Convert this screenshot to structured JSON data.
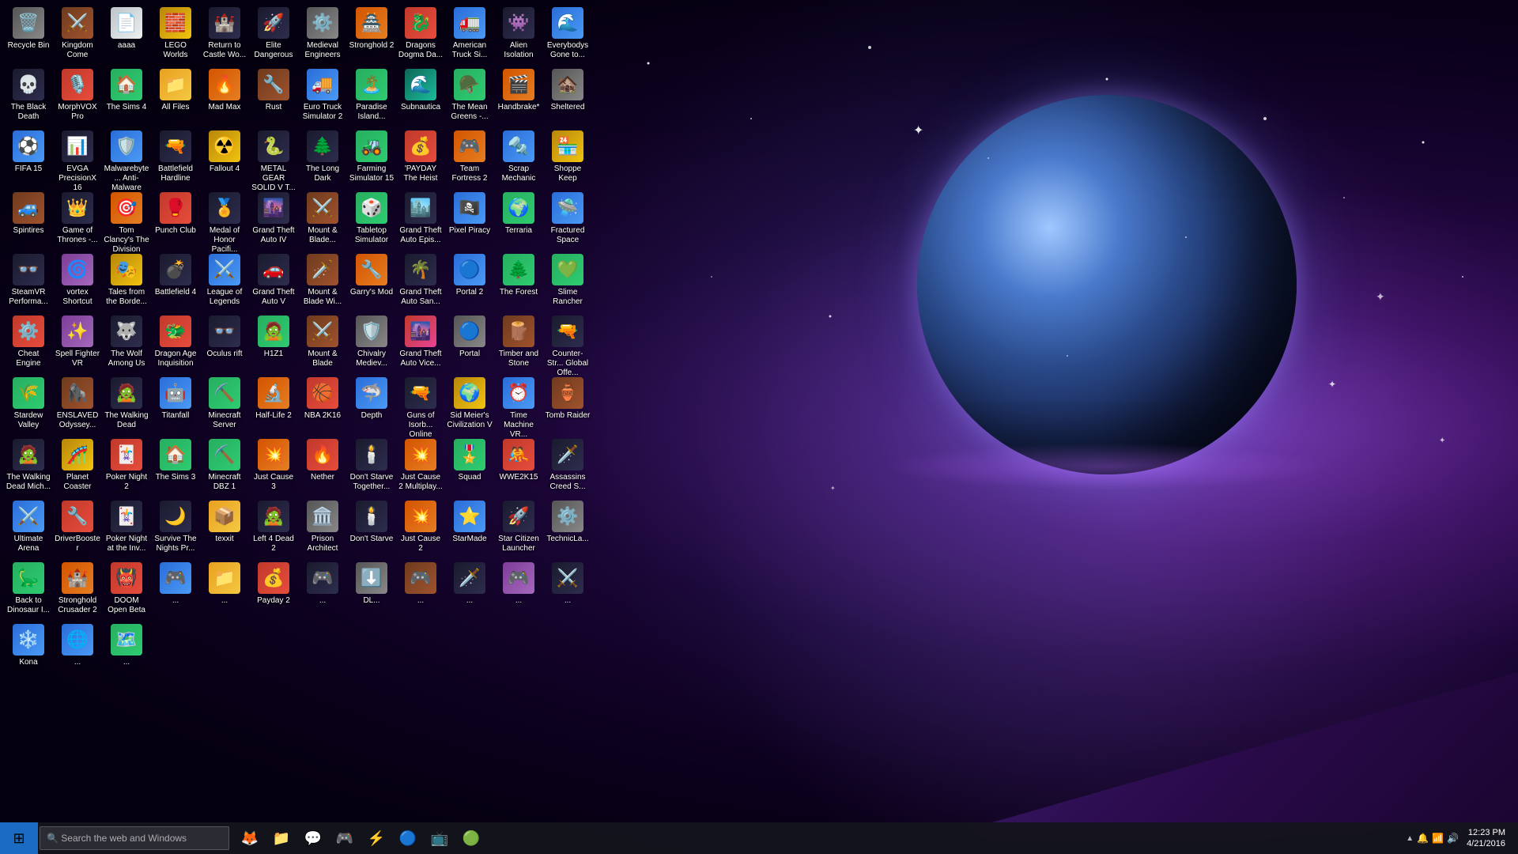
{
  "desktop": {
    "icons": [
      {
        "id": "recycle-bin",
        "label": "Recycle Bin",
        "emoji": "🗑️",
        "color": "ic-gray"
      },
      {
        "id": "kingdom-come",
        "label": "Kingdom Come",
        "emoji": "⚔️",
        "color": "ic-brown"
      },
      {
        "id": "aaaa",
        "label": "aaaa",
        "emoji": "📄",
        "color": "ic-white"
      },
      {
        "id": "lego-worlds",
        "label": "LEGO Worlds",
        "emoji": "🧱",
        "color": "ic-yellow"
      },
      {
        "id": "return-castle",
        "label": "Return to Castle Wo...",
        "emoji": "🏰",
        "color": "ic-dark"
      },
      {
        "id": "elite-dangerous",
        "label": "Elite Dangerous",
        "emoji": "🚀",
        "color": "ic-dark"
      },
      {
        "id": "medieval-engineers",
        "label": "Medieval Engineers",
        "emoji": "⚙️",
        "color": "ic-gray"
      },
      {
        "id": "stronghold-2",
        "label": "Stronghold 2",
        "emoji": "🏯",
        "color": "ic-orange"
      },
      {
        "id": "dragons-dogma",
        "label": "Dragons Dogma Da...",
        "emoji": "🐉",
        "color": "ic-red"
      },
      {
        "id": "american-truck",
        "label": "American Truck Si...",
        "emoji": "🚛",
        "color": "ic-blue"
      },
      {
        "id": "alien-isolation",
        "label": "Alien Isolation",
        "emoji": "👾",
        "color": "ic-dark"
      },
      {
        "id": "everybodys-gone",
        "label": "Everybodys Gone to...",
        "emoji": "🌊",
        "color": "ic-blue"
      },
      {
        "id": "the-black-death",
        "label": "The Black Death",
        "emoji": "💀",
        "color": "ic-dark"
      },
      {
        "id": "morphvox",
        "label": "MorphVOX Pro",
        "emoji": "🎙️",
        "color": "ic-red"
      },
      {
        "id": "the-sims-4",
        "label": "The Sims 4",
        "emoji": "🏠",
        "color": "ic-green"
      },
      {
        "id": "all-files",
        "label": "All Files",
        "emoji": "📁",
        "color": "ic-folder"
      },
      {
        "id": "mad-max",
        "label": "Mad Max",
        "emoji": "🔥",
        "color": "ic-orange"
      },
      {
        "id": "rust",
        "label": "Rust",
        "emoji": "🔧",
        "color": "ic-brown"
      },
      {
        "id": "euro-truck-2",
        "label": "Euro Truck Simulator 2",
        "emoji": "🚚",
        "color": "ic-blue"
      },
      {
        "id": "paradise-island",
        "label": "Paradise Island...",
        "emoji": "🏝️",
        "color": "ic-green"
      },
      {
        "id": "subnautica",
        "label": "Subnautica",
        "emoji": "🌊",
        "color": "ic-teal"
      },
      {
        "id": "the-mean-greens",
        "label": "The Mean Greens -...",
        "emoji": "🪖",
        "color": "ic-green"
      },
      {
        "id": "handbrake",
        "label": "Handbrake*",
        "emoji": "🎬",
        "color": "ic-orange"
      },
      {
        "id": "sheltered",
        "label": "Sheltered",
        "emoji": "🏚️",
        "color": "ic-gray"
      },
      {
        "id": "fifa-15",
        "label": "FIFA 15",
        "emoji": "⚽",
        "color": "ic-blue"
      },
      {
        "id": "evga-precision",
        "label": "EVGA PrecisionX 16",
        "emoji": "📊",
        "color": "ic-dark"
      },
      {
        "id": "malwarebytes",
        "label": "Malwarebyte... Anti-Malware",
        "emoji": "🛡️",
        "color": "ic-blue"
      },
      {
        "id": "battlefield-hardline",
        "label": "Battlefield Hardline",
        "emoji": "🔫",
        "color": "ic-dark"
      },
      {
        "id": "fallout-4",
        "label": "Fallout 4",
        "emoji": "☢️",
        "color": "ic-yellow"
      },
      {
        "id": "metal-gear",
        "label": "METAL GEAR SOLID V T...",
        "emoji": "🐍",
        "color": "ic-dark"
      },
      {
        "id": "the-long-dark",
        "label": "The Long Dark",
        "emoji": "🌲",
        "color": "ic-dark"
      },
      {
        "id": "farming-sim-15",
        "label": "Farming Simulator 15",
        "emoji": "🚜",
        "color": "ic-green"
      },
      {
        "id": "payday-heist",
        "label": "'PAYDAY The Heist",
        "emoji": "💰",
        "color": "ic-red"
      },
      {
        "id": "team-fortress",
        "label": "Team Fortress 2",
        "emoji": "🎮",
        "color": "ic-orange"
      },
      {
        "id": "scrap-mechanic",
        "label": "Scrap Mechanic",
        "emoji": "🔩",
        "color": "ic-blue"
      },
      {
        "id": "shoppe-keep",
        "label": "Shoppe Keep",
        "emoji": "🏪",
        "color": "ic-yellow"
      },
      {
        "id": "spintires",
        "label": "Spintires",
        "emoji": "🚙",
        "color": "ic-brown"
      },
      {
        "id": "game-of-thrones",
        "label": "Game of Thrones -...",
        "emoji": "👑",
        "color": "ic-dark"
      },
      {
        "id": "tom-clancy-division",
        "label": "Tom Clancy's The Division",
        "emoji": "🎯",
        "color": "ic-orange"
      },
      {
        "id": "punch-club",
        "label": "Punch Club",
        "emoji": "🥊",
        "color": "ic-red"
      },
      {
        "id": "medal-honor",
        "label": "Medal of Honor Pacifi...",
        "emoji": "🏅",
        "color": "ic-dark"
      },
      {
        "id": "gta-iv",
        "label": "Grand Theft Auto IV",
        "emoji": "🌆",
        "color": "ic-dark"
      },
      {
        "id": "mount-blade",
        "label": "Mount & Blade...",
        "emoji": "⚔️",
        "color": "ic-brown"
      },
      {
        "id": "tabletop-sim",
        "label": "Tabletop Simulator",
        "emoji": "🎲",
        "color": "ic-green"
      },
      {
        "id": "gta-episodes",
        "label": "Grand Theft Auto Epis...",
        "emoji": "🏙️",
        "color": "ic-dark"
      },
      {
        "id": "pixel-piracy",
        "label": "Pixel Piracy",
        "emoji": "🏴‍☠️",
        "color": "ic-blue"
      },
      {
        "id": "terraria",
        "label": "Terraria",
        "emoji": "🌍",
        "color": "ic-green"
      },
      {
        "id": "fractured-space",
        "label": "Fractured Space",
        "emoji": "🛸",
        "color": "ic-blue"
      },
      {
        "id": "steamvr",
        "label": "SteamVR Performa...",
        "emoji": "👓",
        "color": "ic-dark"
      },
      {
        "id": "vortex",
        "label": "vortex Shortcut",
        "emoji": "🌀",
        "color": "ic-purple"
      },
      {
        "id": "tales-borderlands",
        "label": "Tales from the Borde...",
        "emoji": "🎭",
        "color": "ic-yellow"
      },
      {
        "id": "battlefield-4",
        "label": "Battlefield 4",
        "emoji": "💣",
        "color": "ic-dark"
      },
      {
        "id": "league-legends",
        "label": "League of Legends",
        "emoji": "⚔️",
        "color": "ic-blue"
      },
      {
        "id": "gta-v",
        "label": "Grand Theft Auto V",
        "emoji": "🚗",
        "color": "ic-dark"
      },
      {
        "id": "mount-blade-war",
        "label": "Mount & Blade Wi...",
        "emoji": "🗡️",
        "color": "ic-brown"
      },
      {
        "id": "garrys-mod",
        "label": "Garry's Mod",
        "emoji": "🔧",
        "color": "ic-orange"
      },
      {
        "id": "gta-san",
        "label": "Grand Theft Auto San...",
        "emoji": "🌴",
        "color": "ic-dark"
      },
      {
        "id": "portal-2",
        "label": "Portal 2",
        "emoji": "🔵",
        "color": "ic-blue"
      },
      {
        "id": "the-forest",
        "label": "The Forest",
        "emoji": "🌲",
        "color": "ic-green"
      },
      {
        "id": "slime-rancher",
        "label": "Slime Rancher",
        "emoji": "💚",
        "color": "ic-green"
      },
      {
        "id": "cheat-engine",
        "label": "Cheat Engine",
        "emoji": "⚙️",
        "color": "ic-red"
      },
      {
        "id": "spell-fighter",
        "label": "Spell Fighter VR",
        "emoji": "✨",
        "color": "ic-purple"
      },
      {
        "id": "wolf-among-us",
        "label": "The Wolf Among Us",
        "emoji": "🐺",
        "color": "ic-dark"
      },
      {
        "id": "dragon-age",
        "label": "Dragon Age Inquisition",
        "emoji": "🐲",
        "color": "ic-red"
      },
      {
        "id": "oculus-rift",
        "label": "Oculus rift",
        "emoji": "👓",
        "color": "ic-dark"
      },
      {
        "id": "h1z1",
        "label": "H1Z1",
        "emoji": "🧟",
        "color": "ic-green"
      },
      {
        "id": "mount-blade-2",
        "label": "Mount & Blade",
        "emoji": "⚔️",
        "color": "ic-brown"
      },
      {
        "id": "chivalry",
        "label": "Chivalry Mediev...",
        "emoji": "🛡️",
        "color": "ic-gray"
      },
      {
        "id": "gta-vice",
        "label": "Grand Theft Auto Vice...",
        "emoji": "🌆",
        "color": "ic-pink"
      },
      {
        "id": "portal",
        "label": "Portal",
        "emoji": "🔵",
        "color": "ic-gray"
      },
      {
        "id": "timber-stone",
        "label": "Timber and Stone",
        "emoji": "🪵",
        "color": "ic-brown"
      },
      {
        "id": "csgo",
        "label": "Counter-Str... Global Offe...",
        "emoji": "🔫",
        "color": "ic-dark"
      },
      {
        "id": "stardew",
        "label": "Stardew Valley",
        "emoji": "🌾",
        "color": "ic-green"
      },
      {
        "id": "enslaved",
        "label": "ENSLAVED Odyssey...",
        "emoji": "🦍",
        "color": "ic-brown"
      },
      {
        "id": "walking-dead",
        "label": "The Walking Dead",
        "emoji": "🧟",
        "color": "ic-dark"
      },
      {
        "id": "titanfall",
        "label": "Titanfall",
        "emoji": "🤖",
        "color": "ic-blue"
      },
      {
        "id": "minecraft-server",
        "label": "Minecraft Server",
        "emoji": "⛏️",
        "color": "ic-green"
      },
      {
        "id": "half-life-2",
        "label": "Half-Life 2",
        "emoji": "🔬",
        "color": "ic-orange"
      },
      {
        "id": "nba-2k16",
        "label": "NBA 2K16",
        "emoji": "🏀",
        "color": "ic-red"
      },
      {
        "id": "depth",
        "label": "Depth",
        "emoji": "🦈",
        "color": "ic-blue"
      },
      {
        "id": "guns-online",
        "label": "Guns of Isorb... Online",
        "emoji": "🔫",
        "color": "ic-dark"
      },
      {
        "id": "civ-v",
        "label": "Sid Meier's Civilization V",
        "emoji": "🌍",
        "color": "ic-yellow"
      },
      {
        "id": "time-machine",
        "label": "Time Machine VR...",
        "emoji": "⏰",
        "color": "ic-blue"
      },
      {
        "id": "tomb-raider",
        "label": "Tomb Raider",
        "emoji": "🏺",
        "color": "ic-brown"
      },
      {
        "id": "walking-dead-mich",
        "label": "The Walking Dead Mich...",
        "emoji": "🧟",
        "color": "ic-dark"
      },
      {
        "id": "planet-coaster",
        "label": "Planet Coaster",
        "emoji": "🎢",
        "color": "ic-yellow"
      },
      {
        "id": "poker-night-2",
        "label": "Poker Night 2",
        "emoji": "🃏",
        "color": "ic-red"
      },
      {
        "id": "the-sims-3",
        "label": "The Sims 3",
        "emoji": "🏠",
        "color": "ic-green"
      },
      {
        "id": "minecraft-dbz",
        "label": "Minecraft DBZ 1",
        "emoji": "⛏️",
        "color": "ic-green"
      },
      {
        "id": "just-cause-3",
        "label": "Just Cause 3",
        "emoji": "💥",
        "color": "ic-orange"
      },
      {
        "id": "nether",
        "label": "Nether",
        "emoji": "🔥",
        "color": "ic-red"
      },
      {
        "id": "dont-starve-together",
        "label": "Don't Starve Together...",
        "emoji": "🕯️",
        "color": "ic-dark"
      },
      {
        "id": "just-cause-2-multi",
        "label": "Just Cause 2 Multiplay...",
        "emoji": "💥",
        "color": "ic-orange"
      },
      {
        "id": "squad",
        "label": "Squad",
        "emoji": "🎖️",
        "color": "ic-green"
      },
      {
        "id": "wwe-2k15",
        "label": "WWE2K15",
        "emoji": "🤼",
        "color": "ic-red"
      },
      {
        "id": "assassins-creed",
        "label": "Assassins Creed S...",
        "emoji": "🗡️",
        "color": "ic-dark"
      },
      {
        "id": "ultimate-arena",
        "label": "Ultimate Arena",
        "emoji": "⚔️",
        "color": "ic-blue"
      },
      {
        "id": "driver-booster",
        "label": "DriverBooster",
        "emoji": "🔧",
        "color": "ic-red"
      },
      {
        "id": "poker-night-inv",
        "label": "Poker Night at the Inv...",
        "emoji": "🃏",
        "color": "ic-dark"
      },
      {
        "id": "survive-nights",
        "label": "Survive The Nights Pr...",
        "emoji": "🌙",
        "color": "ic-dark"
      },
      {
        "id": "texxit",
        "label": "texxit",
        "emoji": "📦",
        "color": "ic-folder"
      },
      {
        "id": "left-4-dead-2",
        "label": "Left 4 Dead 2",
        "emoji": "🧟",
        "color": "ic-dark"
      },
      {
        "id": "prison-architect",
        "label": "Prison Architect",
        "emoji": "🏛️",
        "color": "ic-gray"
      },
      {
        "id": "dont-starve",
        "label": "Don't Starve",
        "emoji": "🕯️",
        "color": "ic-dark"
      },
      {
        "id": "just-cause-2",
        "label": "Just Cause 2",
        "emoji": "💥",
        "color": "ic-orange"
      },
      {
        "id": "starmade",
        "label": "StarMade",
        "emoji": "⭐",
        "color": "ic-blue"
      },
      {
        "id": "star-citizen",
        "label": "Star Citizen Launcher",
        "emoji": "🚀",
        "color": "ic-dark"
      },
      {
        "id": "techniclauncher",
        "label": "TechnicLa...",
        "emoji": "⚙️",
        "color": "ic-gray"
      },
      {
        "id": "back-to-dinosaur",
        "label": "Back to Dinosaur I...",
        "emoji": "🦕",
        "color": "ic-green"
      },
      {
        "id": "stronghold-crusader",
        "label": "Stronghold Crusader 2",
        "emoji": "🏰",
        "color": "ic-orange"
      },
      {
        "id": "doom-open-beta",
        "label": "DOOM Open Beta",
        "emoji": "👹",
        "color": "ic-red"
      },
      {
        "id": "icon-row8-1",
        "label": "...",
        "emoji": "🎮",
        "color": "ic-blue"
      },
      {
        "id": "icon-row8-2",
        "label": "...",
        "emoji": "📁",
        "color": "ic-folder"
      },
      {
        "id": "payday-2",
        "label": "Payday 2",
        "emoji": "💰",
        "color": "ic-red"
      },
      {
        "id": "icon-row8-4",
        "label": "...",
        "emoji": "🎮",
        "color": "ic-dark"
      },
      {
        "id": "icon-dl",
        "label": "DL...",
        "emoji": "⬇️",
        "color": "ic-gray"
      },
      {
        "id": "icon-row8-6",
        "label": "...",
        "emoji": "🎮",
        "color": "ic-brown"
      },
      {
        "id": "icon-row8-7",
        "label": "...",
        "emoji": "🗡️",
        "color": "ic-dark"
      },
      {
        "id": "icon-uvr",
        "label": "...",
        "emoji": "🎮",
        "color": "ic-purple"
      },
      {
        "id": "icon-row8-9",
        "label": "...",
        "emoji": "⚔️",
        "color": "ic-dark"
      },
      {
        "id": "kona",
        "label": "Kona",
        "emoji": "❄️",
        "color": "ic-blue"
      },
      {
        "id": "icon-row8-11",
        "label": "...",
        "emoji": "🌐",
        "color": "ic-blue"
      },
      {
        "id": "icon-row8-12",
        "label": "...",
        "emoji": "🗺️",
        "color": "ic-green"
      }
    ]
  },
  "taskbar": {
    "start_label": "⊞",
    "search_placeholder": "🔍 Search the web and Windows",
    "icons": [
      {
        "id": "task-firefox",
        "emoji": "🦊"
      },
      {
        "id": "task-explorer",
        "emoji": "📁"
      },
      {
        "id": "task-skype",
        "emoji": "💬"
      },
      {
        "id": "task-steam",
        "emoji": "🎮"
      },
      {
        "id": "task-nvidia",
        "emoji": "⚡"
      },
      {
        "id": "task-unknown1",
        "emoji": "🔵"
      },
      {
        "id": "task-screen",
        "emoji": "📺"
      },
      {
        "id": "task-unknown2",
        "emoji": "🟢"
      }
    ],
    "clock": "12:23 PM",
    "date": "4/21/2016",
    "tray_icons": [
      "🔔",
      "📶",
      "🔊"
    ]
  }
}
